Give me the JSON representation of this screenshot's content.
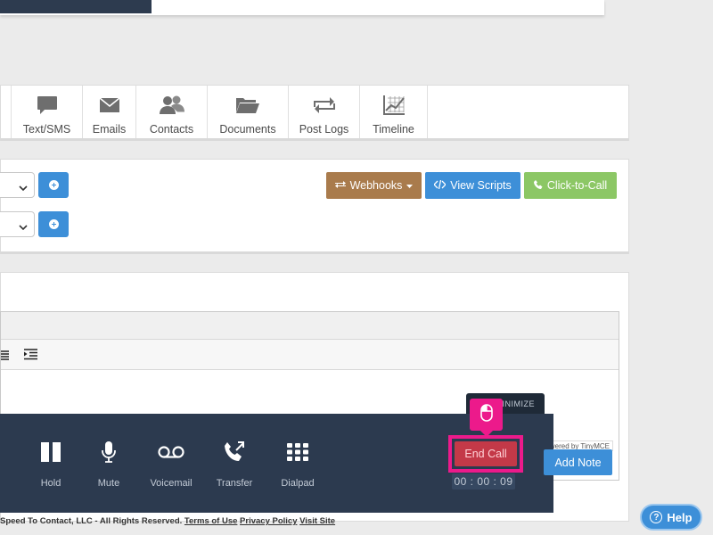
{
  "tabs": [
    {
      "label": "Text/SMS",
      "icon": "chat-bubble-icon"
    },
    {
      "label": "Emails",
      "icon": "envelope-icon"
    },
    {
      "label": "Contacts",
      "icon": "contacts-icon"
    },
    {
      "label": "Documents",
      "icon": "folder-icon"
    },
    {
      "label": "Post Logs",
      "icon": "retweet-icon"
    },
    {
      "label": "Timeline",
      "icon": "timeline-chart-icon"
    }
  ],
  "actions": {
    "webhooks_label": "Webhooks",
    "view_scripts_label": "View Scripts",
    "click_to_call_label": "Click-to-Call"
  },
  "editor": {
    "powered_by": "Powered by TinyMCE"
  },
  "callbar": {
    "minimize_label": "MINIMIZE",
    "controls": [
      {
        "label": "Hold",
        "icon": "pause-icon"
      },
      {
        "label": "Mute",
        "icon": "microphone-icon"
      },
      {
        "label": "Voicemail",
        "icon": "voicemail-icon"
      },
      {
        "label": "Transfer",
        "icon": "phone-forward-icon"
      },
      {
        "label": "Dialpad",
        "icon": "dialpad-icon"
      }
    ],
    "end_call_label": "End Call",
    "timer": "00 : 00 : 09",
    "add_note_label": "Add Note"
  },
  "footer": {
    "copyright": "Speed To Contact, LLC - All Rights Reserved.",
    "terms_link": "Terms of Use",
    "privacy_link": "Privacy Policy",
    "visit_link": "Visit Site"
  },
  "help": {
    "label": "Help"
  },
  "colors": {
    "navy": "#2c3a4f",
    "primary_blue": "#3d8fd8",
    "webhooks_brown": "#a97b4c",
    "call_green": "#8cc765",
    "end_call_red": "#c43948",
    "highlight_pink": "#ec1a8b"
  }
}
